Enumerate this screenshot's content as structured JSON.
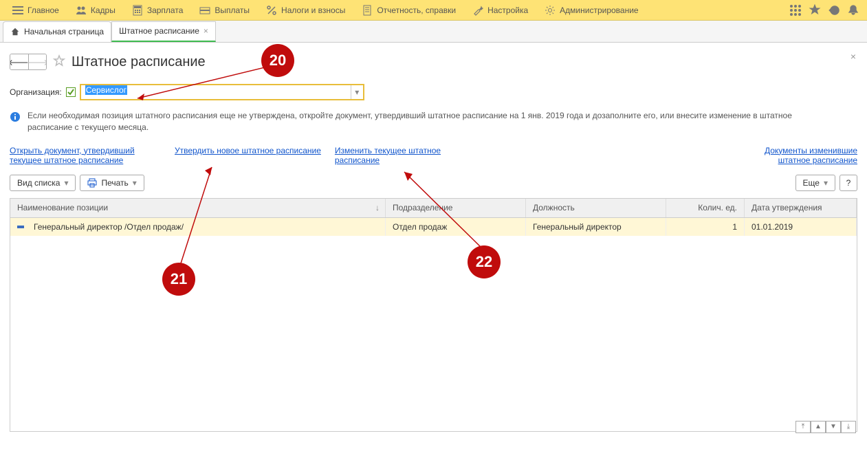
{
  "topmenu": {
    "items": [
      {
        "label": "Главное"
      },
      {
        "label": "Кадры"
      },
      {
        "label": "Зарплата"
      },
      {
        "label": "Выплаты"
      },
      {
        "label": "Налоги и взносы"
      },
      {
        "label": "Отчетность, справки"
      },
      {
        "label": "Настройка"
      },
      {
        "label": "Администрирование"
      }
    ]
  },
  "tabs": {
    "home": "Начальная страница",
    "active": "Штатное расписание"
  },
  "page": {
    "title": "Штатное расписание",
    "org_label": "Организация:",
    "org_value": "Сервислог",
    "info_text": "Если необходимая позиция штатного расписания еще не утверждена, откройте документ, утвердивший штатное расписание на 1 янв. 2019 года и дозаполните его, или внесите изменение в штатное расписание с текущего месяца."
  },
  "links": {
    "open_doc": "Открыть документ, утвердивший текущее штатное расписание",
    "approve_new": "Утвердить новое штатное расписание",
    "change_current": "Изменить текущее штатное расписание",
    "docs_changed": "Документы изменившие штатное расписание"
  },
  "toolbar": {
    "view_list": "Вид списка",
    "print": "Печать",
    "more": "Еще",
    "help": "?"
  },
  "table": {
    "headers": {
      "name": "Наименование позиции",
      "dept": "Подразделение",
      "job": "Должность",
      "qty": "Колич. ед.",
      "date": "Дата утверждения"
    },
    "rows": [
      {
        "name": "Генеральный директор /Отдел продаж/",
        "dept": "Отдел продаж",
        "job": "Генеральный директор",
        "qty": "1",
        "date": "01.01.2019"
      }
    ]
  },
  "callouts": {
    "c20": "20",
    "c21": "21",
    "c22": "22"
  }
}
